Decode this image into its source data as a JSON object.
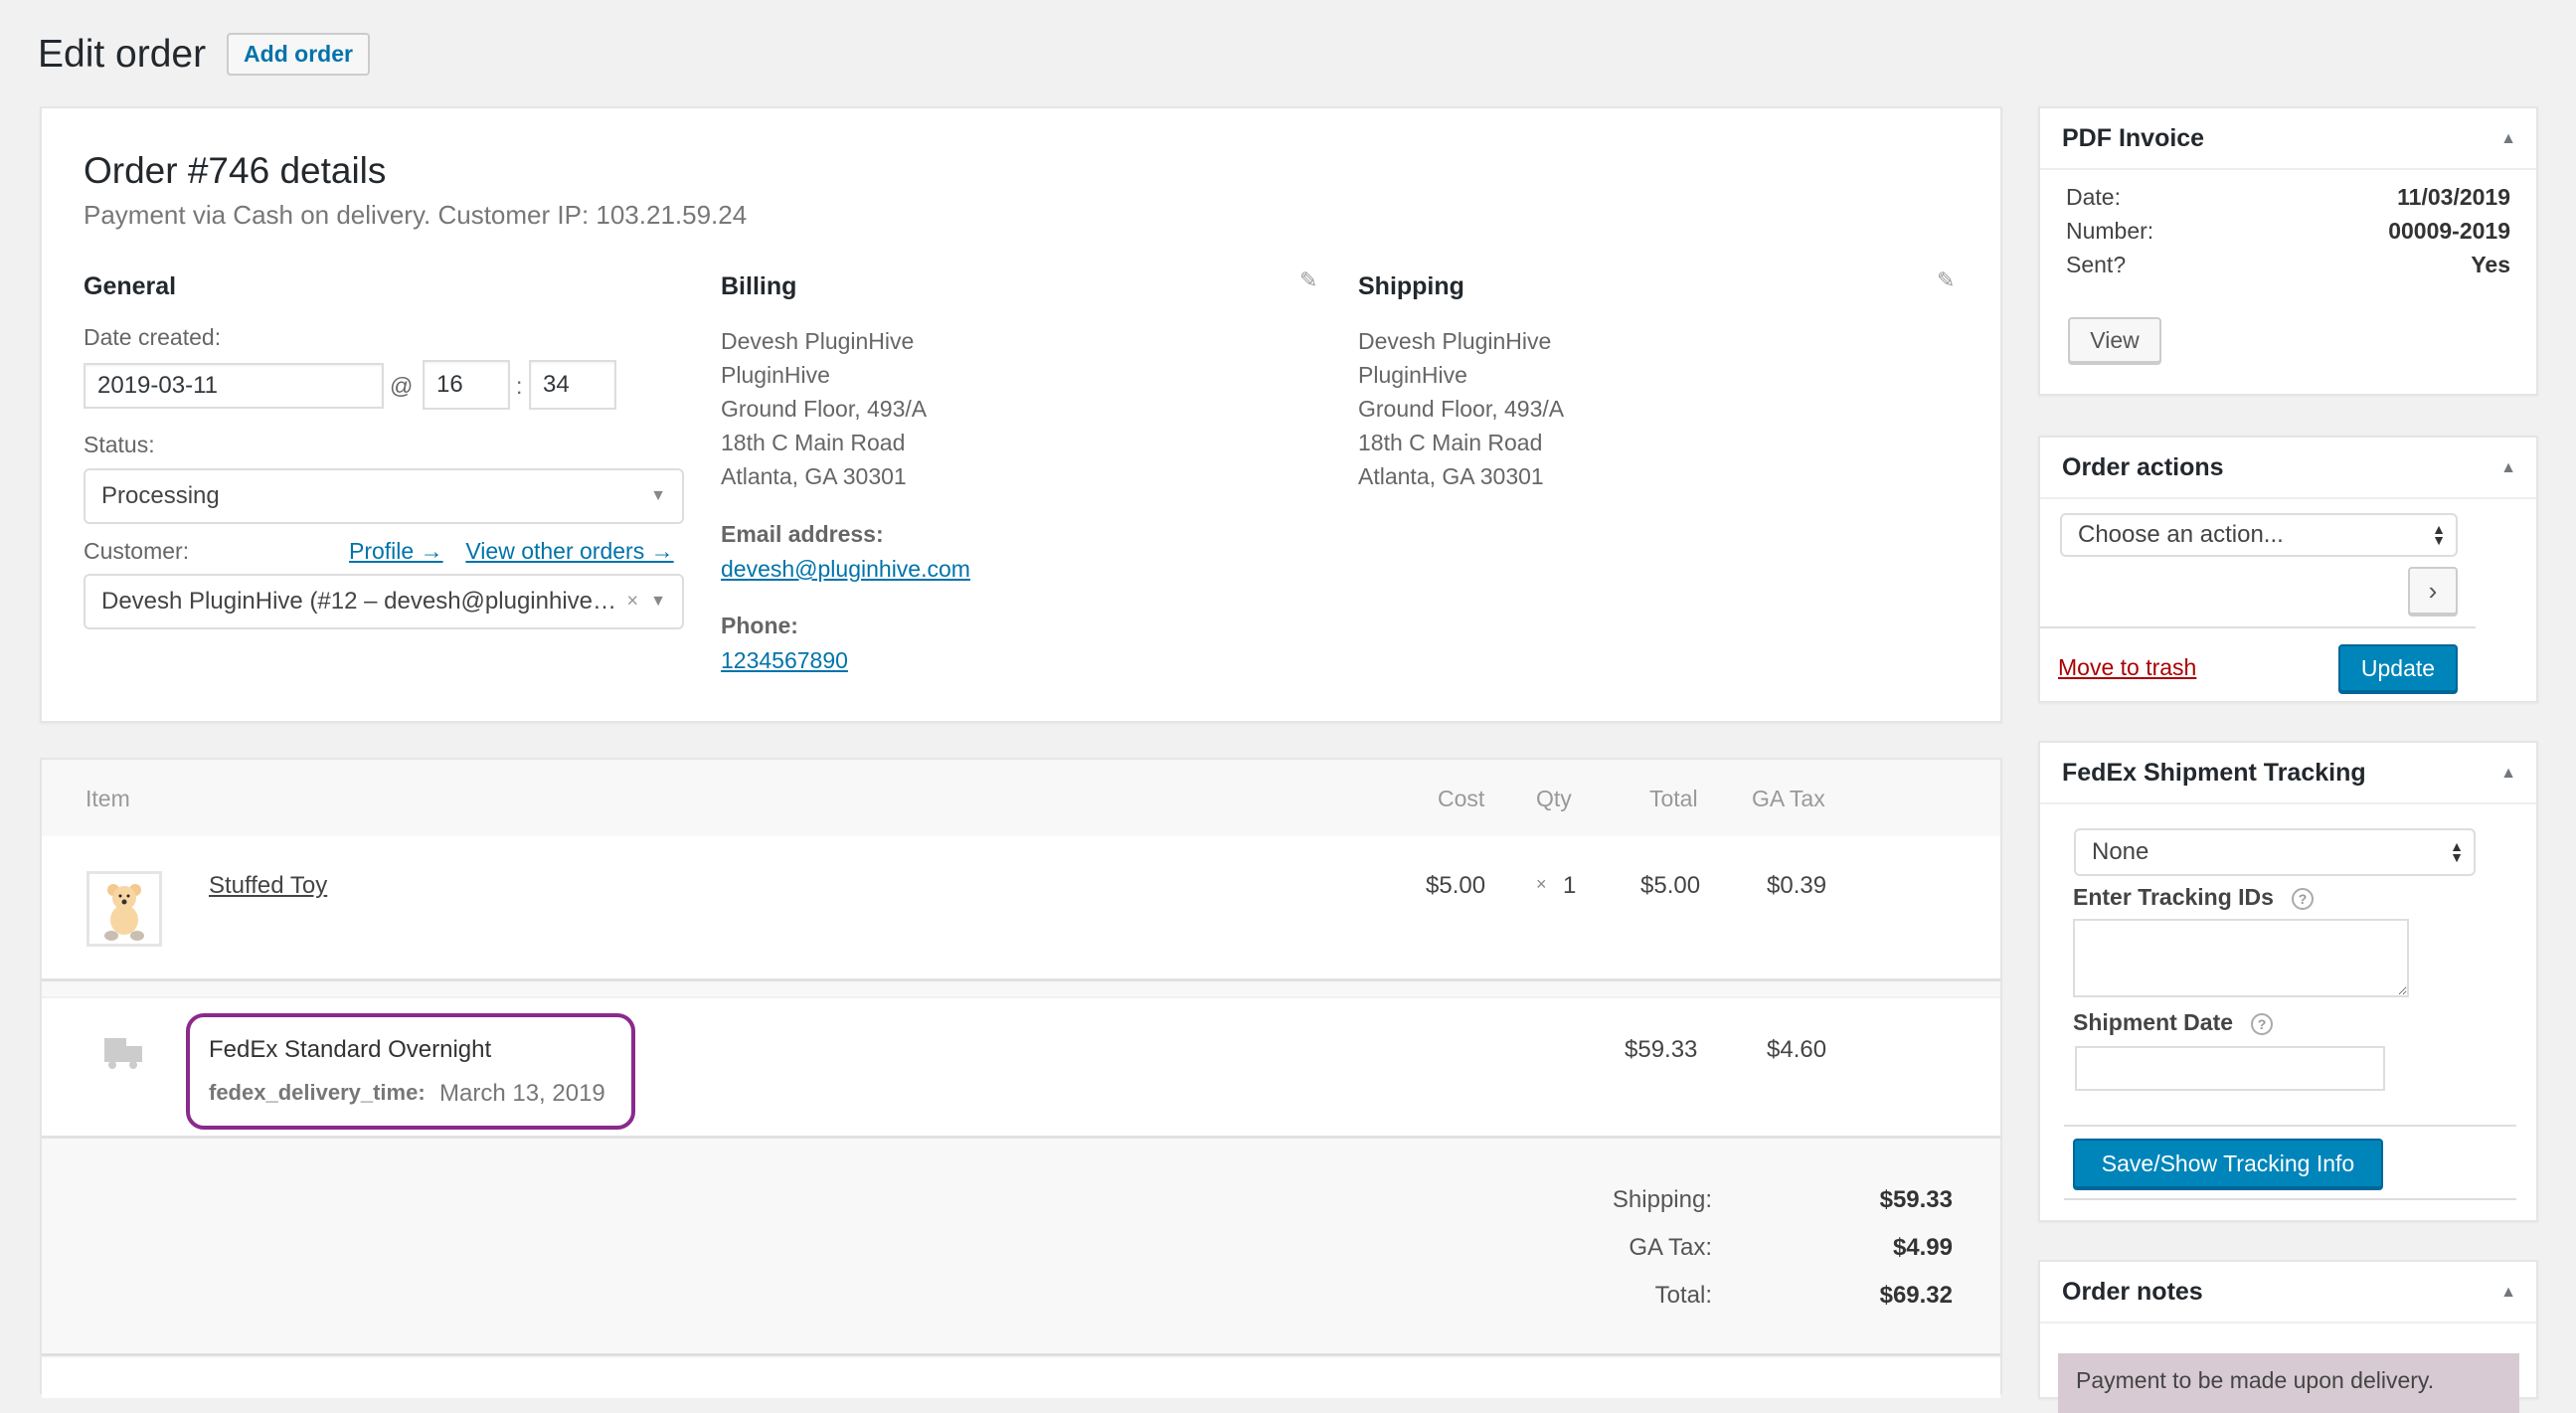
{
  "header": {
    "title": "Edit order",
    "add_order_label": "Add order"
  },
  "order": {
    "title": "Order #746 details",
    "subtitle": "Payment via Cash on delivery. Customer IP: 103.21.59.24",
    "general": {
      "heading": "General",
      "date_label": "Date created:",
      "date_value": "2019-03-11",
      "at": "@",
      "hour": "16",
      "colon": ":",
      "minute": "34",
      "status_label": "Status:",
      "status_value": "Processing",
      "customer_label": "Customer:",
      "profile_link": "Profile →",
      "other_orders_link": "View other orders →",
      "customer_value": "Devesh PluginHive (#12 – devesh@pluginhive…",
      "clear_glyph": "×"
    },
    "billing": {
      "heading": "Billing",
      "address": [
        "Devesh PluginHive",
        "PluginHive",
        "Ground Floor, 493/A",
        "18th C Main Road",
        "Atlanta, GA 30301"
      ],
      "email_label": "Email address:",
      "email": "devesh@pluginhive.com",
      "phone_label": "Phone:",
      "phone": "1234567890"
    },
    "shipping": {
      "heading": "Shipping",
      "address": [
        "Devesh PluginHive",
        "PluginHive",
        "Ground Floor, 493/A",
        "18th C Main Road",
        "Atlanta, GA 30301"
      ]
    }
  },
  "items": {
    "columns": {
      "item": "Item",
      "cost": "Cost",
      "qty": "Qty",
      "total": "Total",
      "tax": "GA Tax"
    },
    "line_items": [
      {
        "name": "Stuffed Toy",
        "cost": "$5.00",
        "qty_prefix": "×",
        "qty": "1",
        "total": "$5.00",
        "tax": "$0.39"
      }
    ],
    "shipping_line": {
      "method": "FedEx Standard Overnight",
      "meta_key": "fedex_delivery_time:",
      "meta_value": "March 13, 2019",
      "total": "$59.33",
      "tax": "$4.60",
      "highlight_color": "#8a2a8c"
    },
    "totals": [
      {
        "label": "Shipping:",
        "value": "$59.33"
      },
      {
        "label": "GA Tax:",
        "value": "$4.99"
      },
      {
        "label": "Total:",
        "value": "$69.32"
      }
    ]
  },
  "sidebar": {
    "pdf_invoice": {
      "title": "PDF Invoice",
      "rows": [
        {
          "label": "Date:",
          "value": "11/03/2019"
        },
        {
          "label": "Number:",
          "value": "00009-2019"
        },
        {
          "label": "Sent?",
          "value": "Yes"
        }
      ],
      "view_label": "View"
    },
    "order_actions": {
      "title": "Order actions",
      "select_value": "Choose an action...",
      "go_glyph": "›",
      "trash_label": "Move to trash",
      "update_label": "Update"
    },
    "fedex_tracking": {
      "title": "FedEx Shipment Tracking",
      "carrier_value": "None",
      "tracking_label": "Enter Tracking IDs",
      "tracking_value": "",
      "date_label": "Shipment Date",
      "date_value": "",
      "save_label": "Save/Show Tracking Info"
    },
    "order_notes": {
      "title": "Order notes",
      "note": "Payment to be made upon delivery."
    },
    "toggle_glyph": "▲"
  },
  "colors": {
    "link": "#0073aa",
    "primary_button": "#0085ba",
    "trash": "#a00",
    "note_bg": "#d7cad2"
  }
}
